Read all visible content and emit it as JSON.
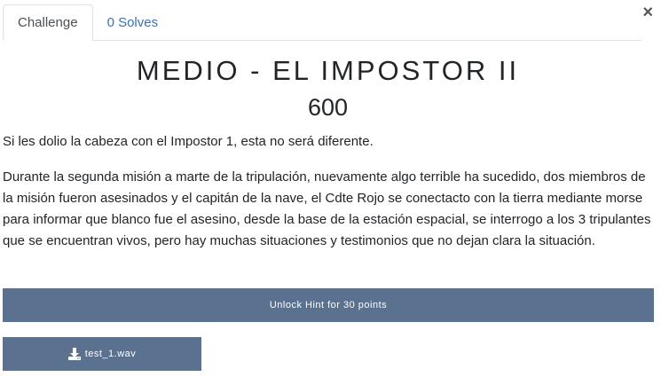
{
  "tabs": [
    {
      "label": "Challenge"
    },
    {
      "label": "0 Solves"
    }
  ],
  "close_label": "×",
  "challenge": {
    "title": "MEDIO - EL IMPOSTOR II",
    "points": "600",
    "description": [
      "Si les dolio la cabeza con el Impostor 1, esta no será diferente.",
      "Durante la segunda misión a marte de la tripulación, nuevamente algo terrible ha sucedido, dos miembros de la misión fueron asesinados y el capitán de la nave, el Cdte Rojo se conectacto con la tierra mediante morse para informar que blanco fue el asesino, desde la base de la estación espacial, se interrogo a los 3 tripulantes que se encuentran vivos, pero hay muchas situaciones y testimonios que no dejan clara la situación."
    ],
    "hint_button": "Unlock Hint for 30 points",
    "file": {
      "name": "test_1.wav",
      "icon": "download-icon"
    }
  },
  "colors": {
    "button_bg": "#5b7190",
    "tab_link": "#3672b5"
  }
}
